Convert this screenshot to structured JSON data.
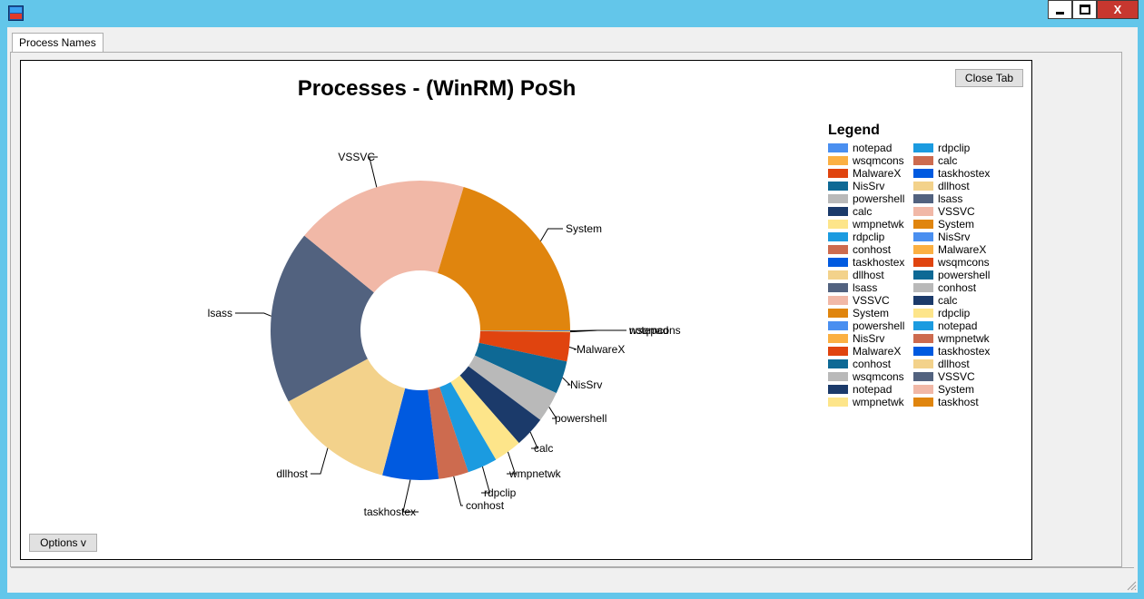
{
  "window": {
    "controls": {
      "minimize_icon": "minimize-icon",
      "maximize_icon": "maximize-icon",
      "close_label": "X"
    }
  },
  "tabs": [
    {
      "label": "Process Names"
    }
  ],
  "chart_panel": {
    "close_tab_label": "Close Tab",
    "options_label": "Options v"
  },
  "legend": {
    "title": "Legend",
    "col1": [
      "notepad",
      "wsqmcons",
      "MalwareX",
      "NisSrv",
      "powershell",
      "calc",
      "wmpnetwk",
      "rdpclip",
      "conhost",
      "taskhostex",
      "dllhost",
      "lsass",
      "VSSVC",
      "System",
      "powershell",
      "NisSrv",
      "MalwareX",
      "conhost",
      "wsqmcons",
      "notepad",
      "wmpnetwk"
    ],
    "col2": [
      "rdpclip",
      "calc",
      "taskhostex",
      "dllhost",
      "lsass",
      "VSSVC",
      "System",
      "NisSrv",
      "MalwareX",
      "wsqmcons",
      "powershell",
      "conhost",
      "calc",
      "rdpclip",
      "notepad",
      "wmpnetwk",
      "taskhostex",
      "dllhost",
      "VSSVC",
      "System",
      "taskhost"
    ]
  },
  "palette": [
    "#4a8ff0",
    "#fbb043",
    "#e0440f",
    "#0e6995",
    "#b9b9b9",
    "#1b3a6a",
    "#fde58a",
    "#1b9be0",
    "#cd6b4f",
    "#005ae0",
    "#f3d28b",
    "#52627f",
    "#f1b8a7",
    "#e0850e"
  ],
  "chart_data": {
    "type": "pie",
    "donut": true,
    "title": "Processes - (WinRM) PoSh",
    "slices": [
      {
        "label": "notepad",
        "value": 0.1
      },
      {
        "label": "wsqmcons",
        "value": 0.1
      },
      {
        "label": "MalwareX",
        "value": 3
      },
      {
        "label": "NisSrv",
        "value": 3.4
      },
      {
        "label": "powershell",
        "value": 3.2
      },
      {
        "label": "calc",
        "value": 3.2
      },
      {
        "label": "wmpnetwk",
        "value": 2.9
      },
      {
        "label": "rdpclip",
        "value": 3.1
      },
      {
        "label": "conhost",
        "value": 3.1
      },
      {
        "label": "taskhostex",
        "value": 5.8
      },
      {
        "label": "dllhost",
        "value": 12.5
      },
      {
        "label": "lsass",
        "value": 18
      },
      {
        "label": "VSSVC",
        "value": 18
      },
      {
        "label": "System",
        "value": 19.5
      }
    ]
  }
}
